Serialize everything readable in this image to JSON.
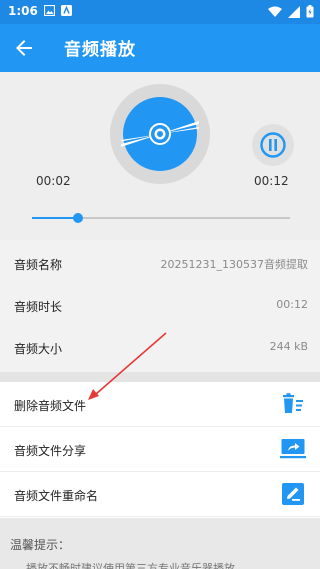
{
  "status_bar": {
    "time": "1:06"
  },
  "app_bar": {
    "title": "音频播放"
  },
  "player": {
    "current_time": "00:02",
    "total_time": "00:12",
    "progress_fraction": 0.18
  },
  "info": [
    {
      "label": "音频名称",
      "value": "20251231_130537音频提取"
    },
    {
      "label": "音频时长",
      "value": "00:12"
    },
    {
      "label": "音频大小",
      "value": "244 kB"
    }
  ],
  "actions": [
    {
      "label": "删除音频文件",
      "icon": "trash-list-icon"
    },
    {
      "label": "音频文件分享",
      "icon": "share-screen-icon"
    },
    {
      "label": "音频文件重命名",
      "icon": "edit-pen-icon"
    }
  ],
  "tips": {
    "title": "温馨提示：",
    "text": "播放不畅时建议使用第三方专业音乐器播放"
  },
  "colors": {
    "primary": "#2196f3",
    "status_bar": "#1e88e5",
    "background": "#f2f2f2",
    "annotation": "#e53935"
  }
}
